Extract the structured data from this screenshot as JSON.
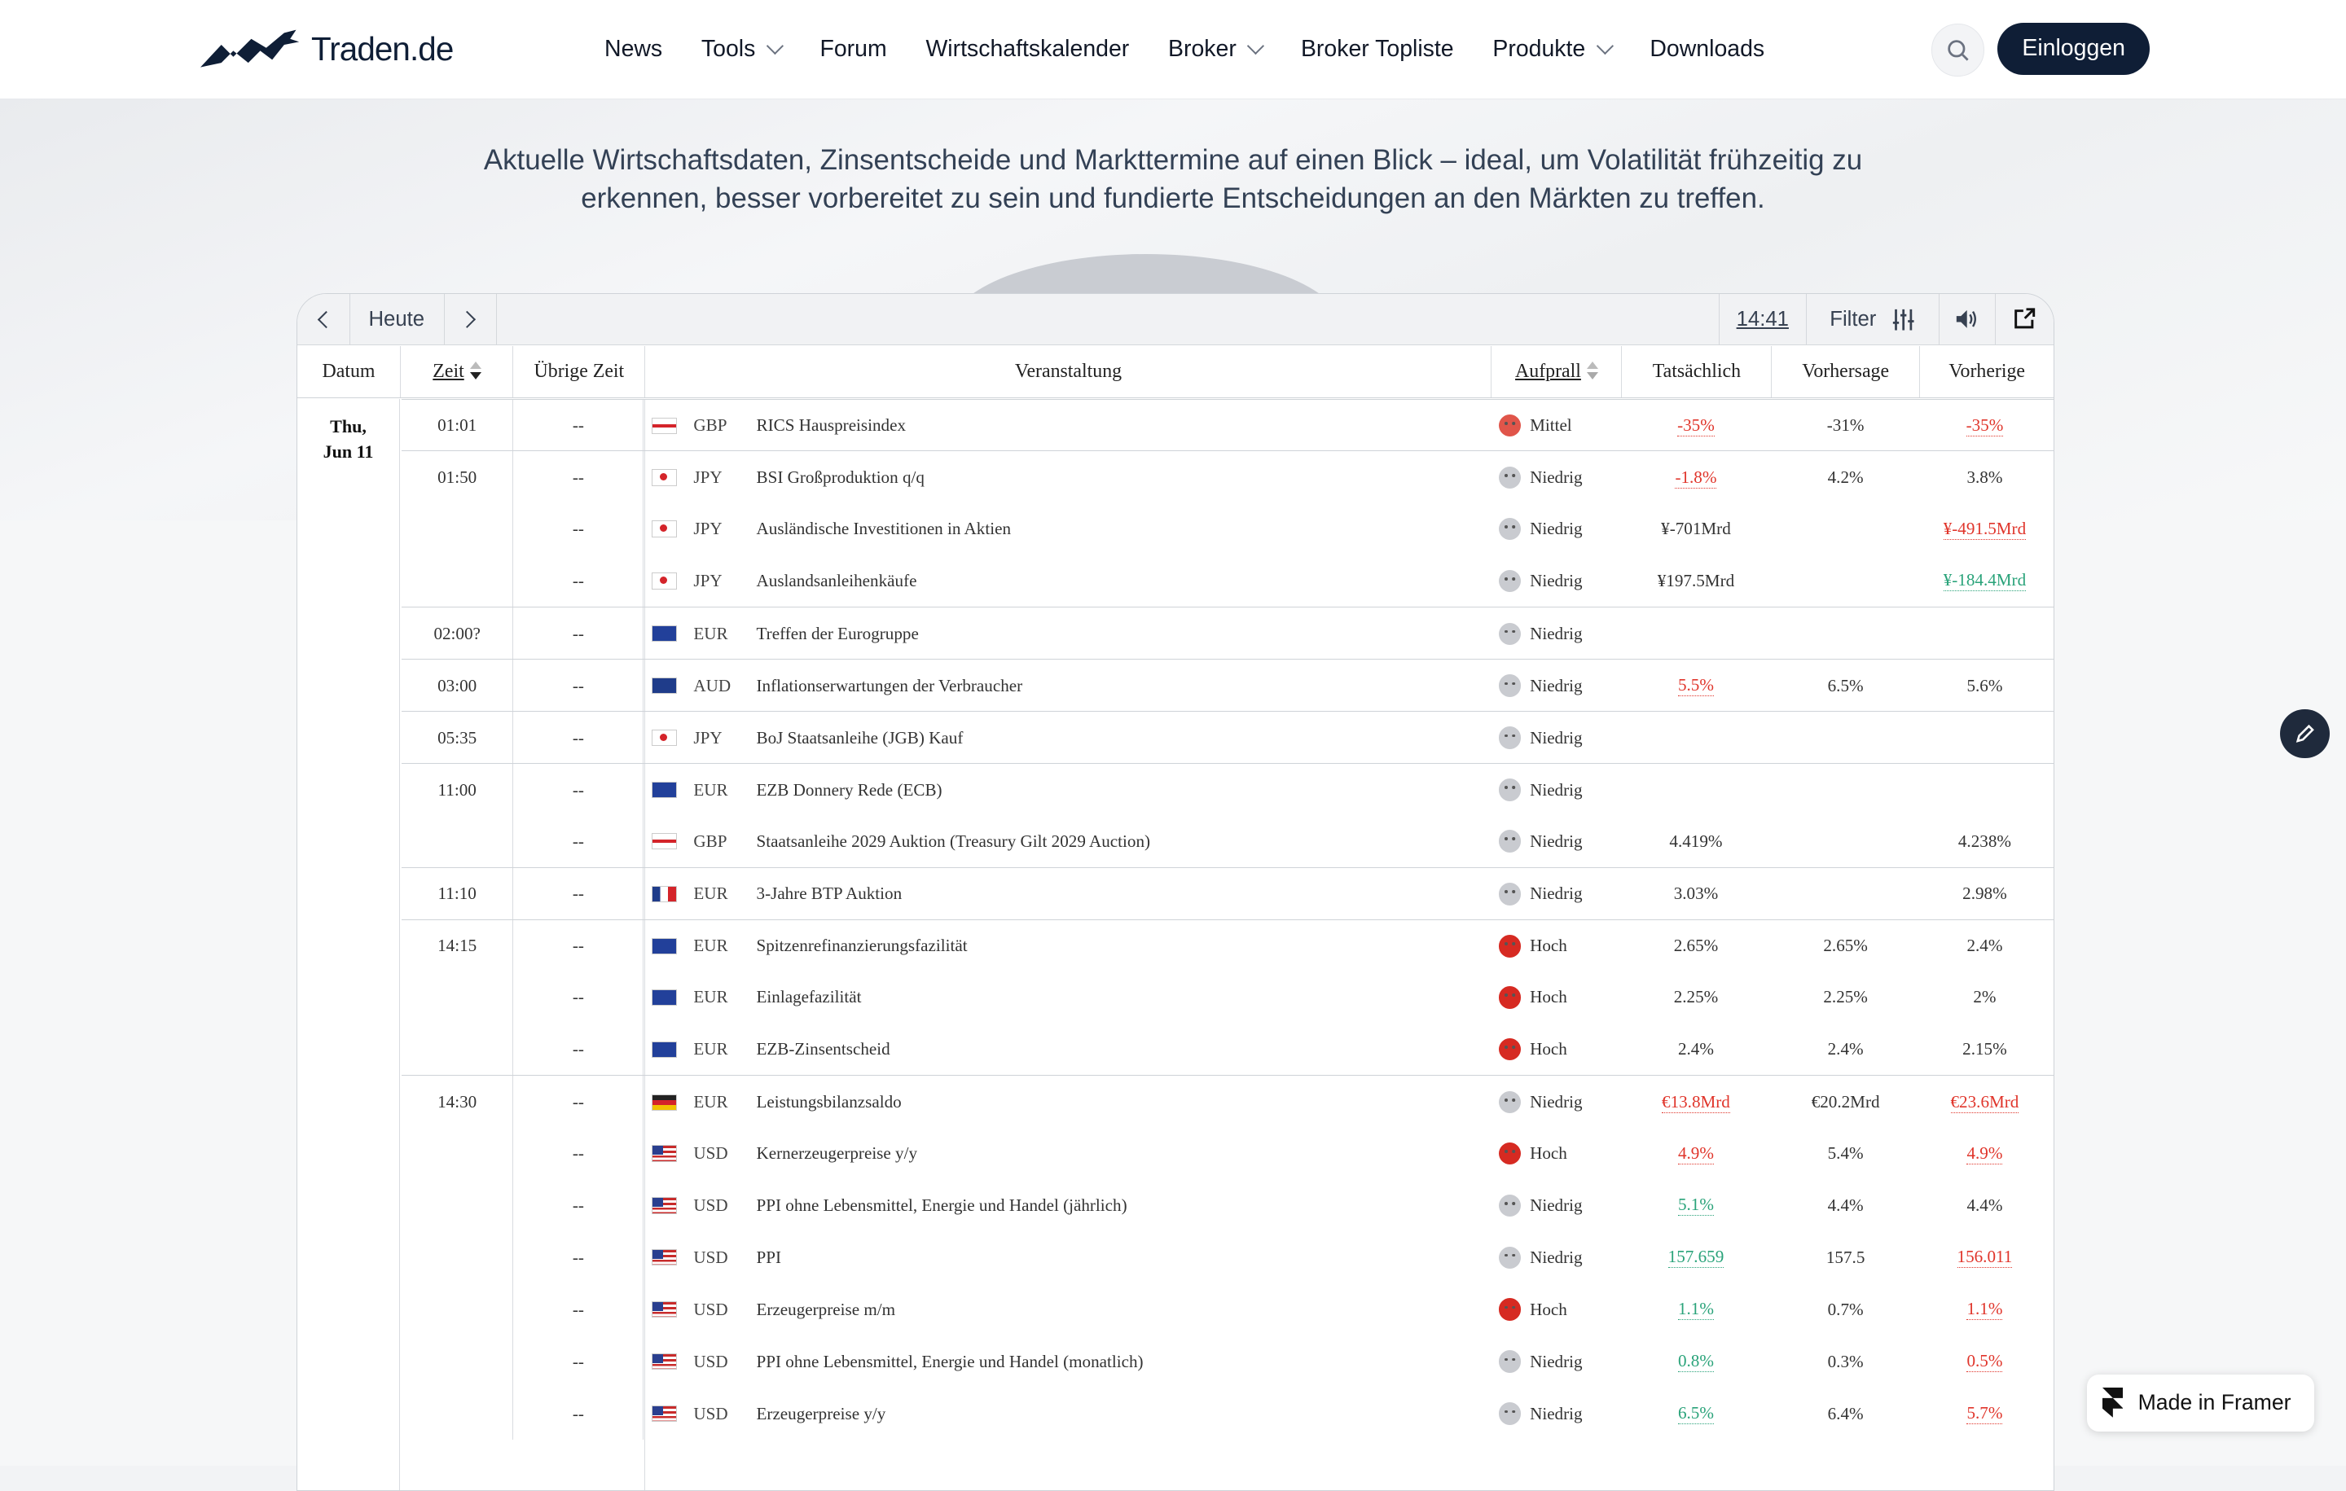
{
  "header": {
    "logo_text": "Traden.de",
    "nav": [
      {
        "label": "News",
        "dropdown": false
      },
      {
        "label": "Tools",
        "dropdown": true
      },
      {
        "label": "Forum",
        "dropdown": false
      },
      {
        "label": "Wirtschaftskalender",
        "dropdown": false
      },
      {
        "label": "Broker",
        "dropdown": true
      },
      {
        "label": "Broker Topliste",
        "dropdown": false
      },
      {
        "label": "Produkte",
        "dropdown": true
      },
      {
        "label": "Downloads",
        "dropdown": false
      }
    ],
    "login_label": "Einloggen"
  },
  "intro_text": "Aktuelle Wirtschaftsdaten, Zinsentscheide und Markttermine auf einen Blick – ideal, um Volatilität frühzeitig zu erkennen, besser vorbereitet zu sein und fundierte Entscheidungen an den Märkten zu treffen.",
  "toolbar": {
    "today_label": "Heute",
    "clock": "14:41",
    "filter_label": "Filter"
  },
  "table": {
    "headers": {
      "datum": "Datum",
      "zeit": "Zeit",
      "uebrige_zeit": "Übrige Zeit",
      "veranstaltung": "Veranstaltung",
      "aufprall": "Aufprall",
      "tatsaechlich": "Tatsächlich",
      "vorhersage": "Vorhersage",
      "vorherige": "Vorherige"
    },
    "date_line1": "Thu,",
    "date_line2": "Jun 11",
    "rows": [
      {
        "time": "01:01",
        "other": "--",
        "flag": "gb",
        "cur": "GBP",
        "event": "RICS Hauspreisindex",
        "impact": "Mittel",
        "level": "med",
        "actual": "-35%",
        "actual_c": "red",
        "forecast": "-31%",
        "prev": "-35%",
        "prev_c": "red",
        "sep": true
      },
      {
        "time": "01:50",
        "other": "--",
        "flag": "jp",
        "cur": "JPY",
        "event": "BSI Großproduktion q/q",
        "impact": "Niedrig",
        "level": "low",
        "actual": "-1.8%",
        "actual_c": "red",
        "forecast": "4.2%",
        "prev": "3.8%",
        "prev_c": "",
        "sep": true
      },
      {
        "time": "",
        "other": "--",
        "flag": "jp",
        "cur": "JPY",
        "event": "Ausländische Investitionen in Aktien",
        "impact": "Niedrig",
        "level": "low",
        "actual": "¥-701Mrd",
        "actual_c": "",
        "forecast": "",
        "prev": "¥-491.5Mrd",
        "prev_c": "red",
        "sep": false
      },
      {
        "time": "",
        "other": "--",
        "flag": "jp",
        "cur": "JPY",
        "event": "Auslandsanleihenkäufe",
        "impact": "Niedrig",
        "level": "low",
        "actual": "¥197.5Mrd",
        "actual_c": "",
        "forecast": "",
        "prev": "¥-184.4Mrd",
        "prev_c": "green",
        "sep": false
      },
      {
        "time": "02:00?",
        "other": "--",
        "flag": "eu",
        "cur": "EUR",
        "event": "Treffen der Eurogruppe",
        "impact": "Niedrig",
        "level": "low",
        "actual": "",
        "actual_c": "",
        "forecast": "",
        "prev": "",
        "prev_c": "",
        "sep": true
      },
      {
        "time": "03:00",
        "other": "--",
        "flag": "au",
        "cur": "AUD",
        "event": "Inflationserwartungen der Verbraucher",
        "impact": "Niedrig",
        "level": "low",
        "actual": "5.5%",
        "actual_c": "red",
        "forecast": "6.5%",
        "prev": "5.6%",
        "prev_c": "",
        "sep": true
      },
      {
        "time": "05:35",
        "other": "--",
        "flag": "jp",
        "cur": "JPY",
        "event": "BoJ Staatsanleihe (JGB) Kauf",
        "impact": "Niedrig",
        "level": "low",
        "actual": "",
        "actual_c": "",
        "forecast": "",
        "prev": "",
        "prev_c": "",
        "sep": true
      },
      {
        "time": "11:00",
        "other": "--",
        "flag": "eu",
        "cur": "EUR",
        "event": "EZB Donnery Rede (ECB)",
        "impact": "Niedrig",
        "level": "low",
        "actual": "",
        "actual_c": "",
        "forecast": "",
        "prev": "",
        "prev_c": "",
        "sep": true
      },
      {
        "time": "",
        "other": "--",
        "flag": "gb",
        "cur": "GBP",
        "event": "Staatsanleihe 2029 Auktion (Treasury Gilt 2029 Auction)",
        "impact": "Niedrig",
        "level": "low",
        "actual": "4.419%",
        "actual_c": "",
        "forecast": "",
        "prev": "4.238%",
        "prev_c": "",
        "sep": false
      },
      {
        "time": "11:10",
        "other": "--",
        "flag": "fr",
        "cur": "EUR",
        "event": "3-Jahre BTP Auktion",
        "impact": "Niedrig",
        "level": "low",
        "actual": "3.03%",
        "actual_c": "",
        "forecast": "",
        "prev": "2.98%",
        "prev_c": "",
        "sep": true
      },
      {
        "time": "14:15",
        "other": "--",
        "flag": "eu",
        "cur": "EUR",
        "event": "Spitzenrefinanzierungsfazilität",
        "impact": "Hoch",
        "level": "high",
        "actual": "2.65%",
        "actual_c": "",
        "forecast": "2.65%",
        "prev": "2.4%",
        "prev_c": "",
        "sep": true
      },
      {
        "time": "",
        "other": "--",
        "flag": "eu",
        "cur": "EUR",
        "event": "Einlagefazilität",
        "impact": "Hoch",
        "level": "high",
        "actual": "2.25%",
        "actual_c": "",
        "forecast": "2.25%",
        "prev": "2%",
        "prev_c": "",
        "sep": false
      },
      {
        "time": "",
        "other": "--",
        "flag": "eu",
        "cur": "EUR",
        "event": "EZB-Zinsentscheid",
        "impact": "Hoch",
        "level": "high",
        "actual": "2.4%",
        "actual_c": "",
        "forecast": "2.4%",
        "prev": "2.15%",
        "prev_c": "",
        "sep": false
      },
      {
        "time": "14:30",
        "other": "--",
        "flag": "de",
        "cur": "EUR",
        "event": "Leistungsbilanzsaldo",
        "impact": "Niedrig",
        "level": "low",
        "actual": "€13.8Mrd",
        "actual_c": "red",
        "forecast": "€20.2Mrd",
        "prev": "€23.6Mrd",
        "prev_c": "red",
        "sep": true
      },
      {
        "time": "",
        "other": "--",
        "flag": "us",
        "cur": "USD",
        "event": "Kernerzeugerpreise y/y",
        "impact": "Hoch",
        "level": "high",
        "actual": "4.9%",
        "actual_c": "red",
        "forecast": "5.4%",
        "prev": "4.9%",
        "prev_c": "red",
        "sep": false
      },
      {
        "time": "",
        "other": "--",
        "flag": "us",
        "cur": "USD",
        "event": "PPI ohne Lebensmittel, Energie und Handel (jährlich)",
        "impact": "Niedrig",
        "level": "low",
        "actual": "5.1%",
        "actual_c": "green",
        "forecast": "4.4%",
        "prev": "4.4%",
        "prev_c": "",
        "sep": false
      },
      {
        "time": "",
        "other": "--",
        "flag": "us",
        "cur": "USD",
        "event": "PPI",
        "impact": "Niedrig",
        "level": "low",
        "actual": "157.659",
        "actual_c": "green",
        "forecast": "157.5",
        "prev": "156.011",
        "prev_c": "red",
        "sep": false
      },
      {
        "time": "",
        "other": "--",
        "flag": "us",
        "cur": "USD",
        "event": "Erzeugerpreise m/m",
        "impact": "Hoch",
        "level": "high",
        "actual": "1.1%",
        "actual_c": "green",
        "forecast": "0.7%",
        "prev": "1.1%",
        "prev_c": "red",
        "sep": false
      },
      {
        "time": "",
        "other": "--",
        "flag": "us",
        "cur": "USD",
        "event": "PPI ohne Lebensmittel, Energie und Handel (monatlich)",
        "impact": "Niedrig",
        "level": "low",
        "actual": "0.8%",
        "actual_c": "green",
        "forecast": "0.3%",
        "prev": "0.5%",
        "prev_c": "red",
        "sep": false
      },
      {
        "time": "",
        "other": "--",
        "flag": "us",
        "cur": "USD",
        "event": "Erzeugerpreise y/y",
        "impact": "Niedrig",
        "level": "low",
        "actual": "6.5%",
        "actual_c": "green",
        "forecast": "6.4%",
        "prev": "5.7%",
        "prev_c": "red",
        "sep": false
      }
    ]
  },
  "framer_badge": "Made in Framer",
  "colors": {
    "brand": "#0f1e36",
    "negative": "#e0352b",
    "positive": "#2aa37a"
  }
}
